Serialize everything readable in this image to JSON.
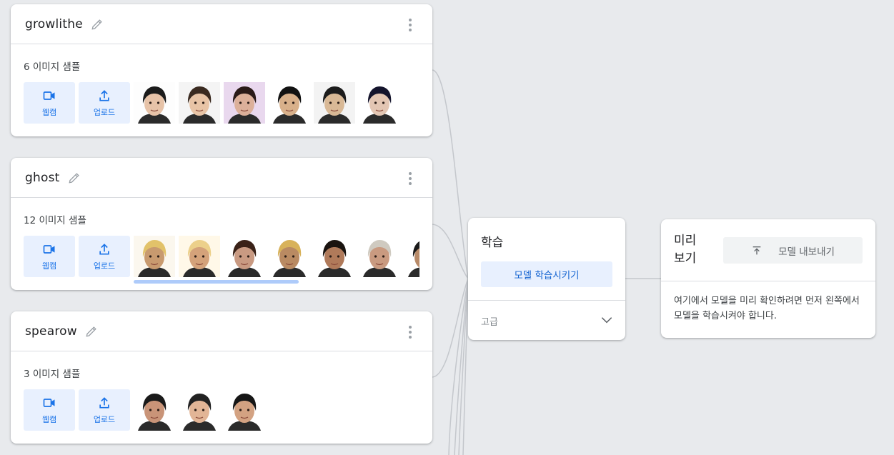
{
  "classes": [
    {
      "name": "growlithe",
      "sample_count": "6 이미지 샘플",
      "webcam_label": "웹캠",
      "upload_label": "업로드",
      "thumbnails": [
        {
          "hair": "#1b1b1b",
          "skin": "#e7c3a8",
          "bg": "#fdfdfd"
        },
        {
          "hair": "#3a2a20",
          "skin": "#e8c4a6",
          "bg": "#f4f4f4"
        },
        {
          "hair": "#2a1a18",
          "skin": "#dcb09a",
          "bg": "#e9d8ee"
        },
        {
          "hair": "#121212",
          "skin": "#d8b08a",
          "bg": "#ffffff"
        },
        {
          "hair": "#1c1c1c",
          "skin": "#d9b996",
          "bg": "#f3f3f3"
        },
        {
          "hair": "#14142c",
          "skin": "#e3c6b3",
          "bg": "#ffffff"
        }
      ]
    },
    {
      "name": "ghost",
      "sample_count": "12 이미지 샘플",
      "webcam_label": "웹캠",
      "upload_label": "업로드",
      "thumbnails": [
        {
          "hair": "#e2c26a",
          "skin": "#c89a6f",
          "bg": "#fbf7ee"
        },
        {
          "hair": "#ecd08a",
          "skin": "#d4a27a",
          "bg": "#fff8e8"
        },
        {
          "hair": "#3a2218",
          "skin": "#c99a82",
          "bg": "#ffffff"
        },
        {
          "hair": "#d8b25a",
          "skin": "#b98a62",
          "bg": "#ffffff"
        },
        {
          "hair": "#1a1410",
          "skin": "#b07a5a",
          "bg": "#ffffff"
        },
        {
          "hair": "#cfcac0",
          "skin": "#c99a80",
          "bg": "#ffffff"
        },
        {
          "hair": "#1a1a1a",
          "skin": "#b88a68",
          "bg": "#ffffff"
        }
      ]
    },
    {
      "name": "spearow",
      "sample_count": "3 이미지 샘플",
      "webcam_label": "웹캠",
      "upload_label": "업로드",
      "thumbnails": [
        {
          "hair": "#1a1a1a",
          "skin": "#c99478",
          "bg": "#ffffff"
        },
        {
          "hair": "#222222",
          "skin": "#e2b596",
          "bg": "#ffffff"
        },
        {
          "hair": "#161616",
          "skin": "#d3a282",
          "bg": "#ffffff"
        }
      ]
    }
  ],
  "training": {
    "title": "학습",
    "train_button": "모델 학습시키기",
    "advanced_label": "고급"
  },
  "preview": {
    "title_line1": "미리",
    "title_line2": "보기",
    "export_button": "모델 내보내기",
    "message": "여기에서 모델을 미리 확인하려면 먼저 왼쪽에서 모델을 학습시켜야 합니다."
  },
  "colors": {
    "accent": "#1a73e8",
    "button_bg": "#e8f0fe",
    "page_bg": "#e8eaed"
  }
}
